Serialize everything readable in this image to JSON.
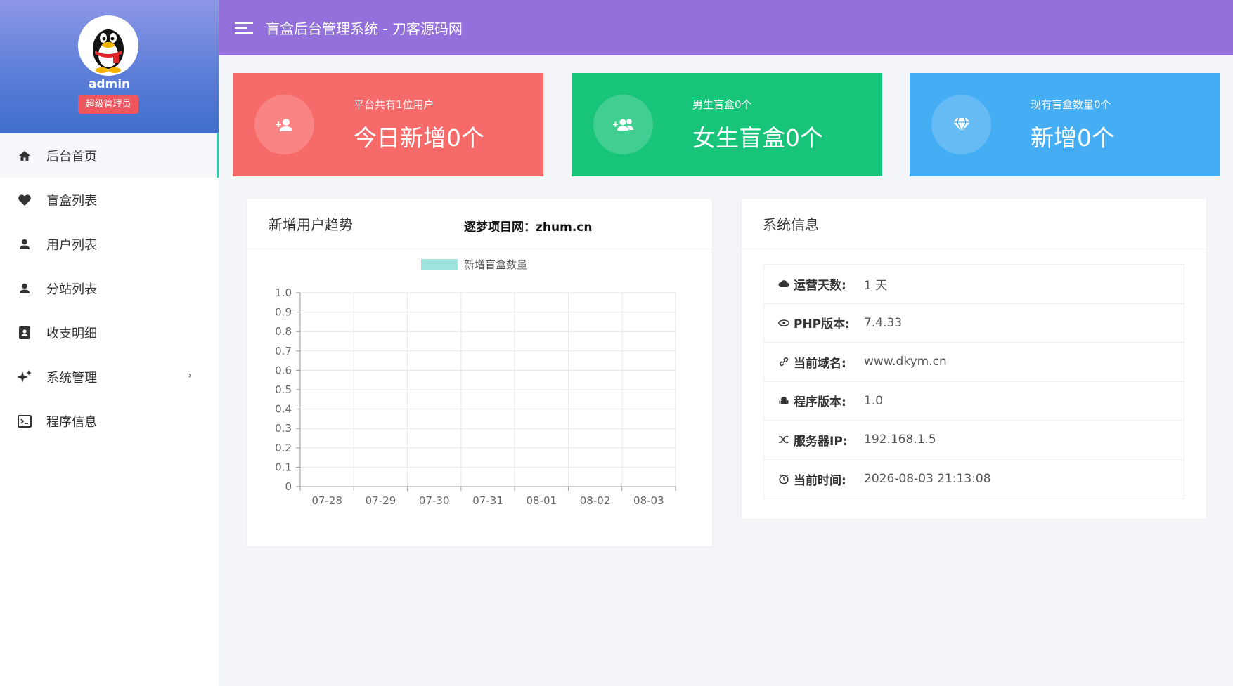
{
  "header": {
    "title": "盲盒后台管理系统 - 刀客源码网"
  },
  "profile": {
    "name": "admin",
    "role": "超级管理员"
  },
  "sidebar": {
    "items": [
      {
        "label": "后台首页",
        "icon": "home-icon"
      },
      {
        "label": "盲盒列表",
        "icon": "heart-icon"
      },
      {
        "label": "用户列表",
        "icon": "user-icon"
      },
      {
        "label": "分站列表",
        "icon": "user-icon"
      },
      {
        "label": "收支明细",
        "icon": "contact-book-icon"
      },
      {
        "label": "系统管理",
        "icon": "sparkle-icon"
      },
      {
        "label": "程序信息",
        "icon": "terminal-icon"
      }
    ]
  },
  "cards": [
    {
      "small": "平台共有1位用户",
      "big": "今日新增0个",
      "color": "#f76a6a",
      "icon": "user-add-icon"
    },
    {
      "small": "男生盲盒0个",
      "big": "女生盲盒0个",
      "color": "#18c47a",
      "icon": "users-add-icon"
    },
    {
      "small": "现有盲盒数量0个",
      "big": "新增0个",
      "color": "#45adf3",
      "icon": "diamond-icon"
    }
  ],
  "trend_panel": {
    "title": "新增用户趋势",
    "watermark": "逐梦项目网：zhum.cn"
  },
  "chart_data": {
    "type": "bar",
    "categories": [
      "07-28",
      "07-29",
      "07-30",
      "07-31",
      "08-01",
      "08-02",
      "08-03"
    ],
    "series": [
      {
        "name": "新增盲盒数量",
        "values": [
          0,
          0,
          0,
          0,
          0,
          0,
          0
        ],
        "color": "#9fe3dd"
      }
    ],
    "ylim": [
      0,
      1.0
    ],
    "yticks": [
      "0",
      "0.1",
      "0.2",
      "0.3",
      "0.4",
      "0.5",
      "0.6",
      "0.7",
      "0.8",
      "0.9",
      "1.0"
    ],
    "grid": true,
    "legend": "top-center"
  },
  "sys_panel": {
    "title": "系统信息",
    "rows": [
      {
        "label": "运营天数:",
        "value": "1 天",
        "icon": "cloud-icon"
      },
      {
        "label": "PHP版本:",
        "value": "7.4.33",
        "icon": "eye-icon"
      },
      {
        "label": "当前域名:",
        "value": "www.dkym.cn",
        "icon": "link-icon"
      },
      {
        "label": "程序版本:",
        "value": "1.0",
        "icon": "android-icon"
      },
      {
        "label": "服务器IP:",
        "value": "192.168.1.5",
        "icon": "shuffle-icon"
      },
      {
        "label": "当前时间:",
        "value": "2026-08-03 21:13:08",
        "icon": "clock-icon"
      }
    ]
  }
}
